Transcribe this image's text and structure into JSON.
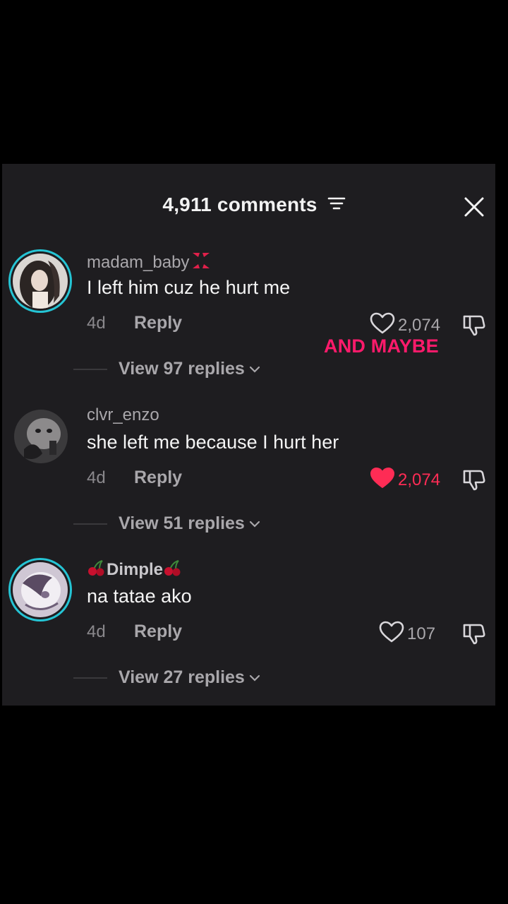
{
  "header": {
    "title": "4,911 comments"
  },
  "overlay_caption": "AND MAYBE",
  "comments": [
    {
      "username": "madam_baby",
      "text": "I left him cuz he hurt me",
      "time": "4d",
      "reply_label": "Reply",
      "likes": "2,074",
      "liked": false,
      "view_replies": "View 97 replies"
    },
    {
      "username": "clvr_enzo",
      "text": "she left me because I hurt her",
      "time": "4d",
      "reply_label": "Reply",
      "likes": "2,074",
      "liked": true,
      "view_replies": "View 51 replies"
    },
    {
      "username": "Dimple",
      "text": "na tatae ako",
      "time": "4d",
      "reply_label": "Reply",
      "likes": "107",
      "liked": false,
      "view_replies": "View 27 replies"
    }
  ],
  "colors": {
    "panel": "#1e1d20",
    "accent_like": "#fe2c55",
    "ring": "#25c4d4",
    "caption": "#ff1a6b"
  },
  "icons": [
    "filter-icon",
    "close-icon",
    "heart-icon",
    "dislike-icon",
    "chevron-down-icon",
    "anger-emoji-icon",
    "cherry-emoji-icon"
  ]
}
